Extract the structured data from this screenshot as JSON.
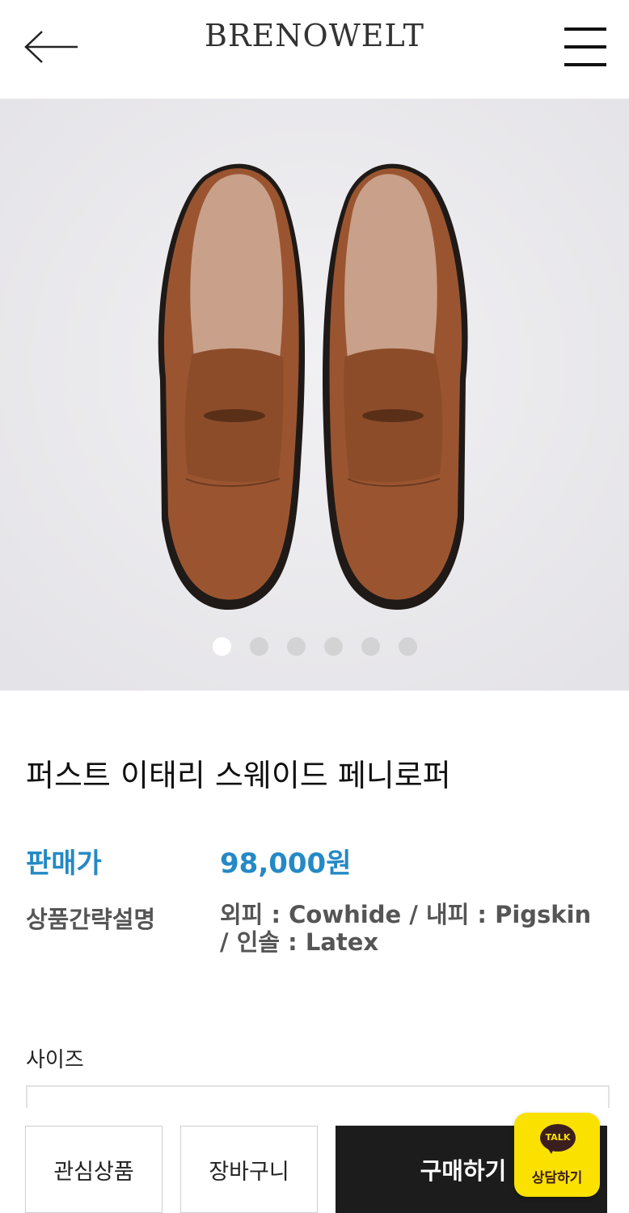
{
  "header": {
    "brand": "BRENOWELT",
    "back_icon": "arrow-left-icon",
    "menu_icon": "hamburger-menu-icon"
  },
  "gallery": {
    "image": "brown-suede-penny-loafers",
    "slide_count": 6,
    "active_index": 0
  },
  "product": {
    "title": "퍼스트 이태리 스웨이드 페니로퍼",
    "price_label": "판매가",
    "price_value": "98,000원",
    "desc_label": "상품간략설명",
    "desc_value": "외피 : Cowhide / 내피 : Pigskin / 인솔 : Latex"
  },
  "options": {
    "size_label": "사이즈"
  },
  "actions": {
    "wishlist_label": "관심상품",
    "cart_label": "장바구니",
    "buy_label": "구매하기"
  },
  "chat": {
    "icon_text": "TALK",
    "label": "상담하기"
  },
  "colors": {
    "accent": "#2489c5",
    "buy_button": "#1c1c1c",
    "kakao_yellow": "#fae100",
    "hero_bg": "#eae9ec"
  }
}
